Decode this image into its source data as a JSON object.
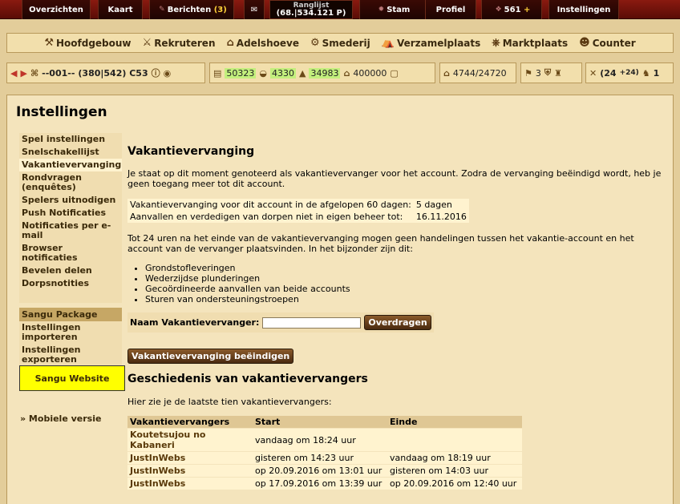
{
  "topbar": {
    "overview": "Overzichten",
    "map": "Kaart",
    "reports": "Berichten",
    "reports_count": "(3)",
    "ranking": "Ranglijst",
    "ranking_value": "(68.|534.121 P)",
    "tribe": "Stam",
    "profile": "Profiel",
    "premium": "561",
    "premium_plus": "+",
    "settings": "Instellingen"
  },
  "buildings": [
    {
      "label": "Hoofdgebouw",
      "icon": "hammer-icon"
    },
    {
      "label": "Rekruteren",
      "icon": "swords-icon"
    },
    {
      "label": "Adelshoeve",
      "icon": "house-icon"
    },
    {
      "label": "Smederij",
      "icon": "anvil-icon"
    },
    {
      "label": "Verzamelplaats",
      "icon": "tent-icon"
    },
    {
      "label": "Marktplaats",
      "icon": "wheel-icon"
    },
    {
      "label": "Counter",
      "icon": "person-icon"
    }
  ],
  "village": {
    "name": "--001--",
    "coords": "(380|542) C53"
  },
  "resources": {
    "wood": "50323",
    "clay": "4330",
    "iron": "34983",
    "storage": "400000",
    "population": "4744/24720"
  },
  "counters": {
    "a": "3",
    "attacks": "(24",
    "attacks_plus": "+24)",
    "support": "1"
  },
  "page_title": "Instellingen",
  "menu": [
    "Spel instellingen",
    "Snelschakellijst",
    "Vakantievervanging",
    "Rondvragen (enquêtes)",
    "Spelers uitnodigen",
    "Push Notificaties",
    "Notificaties per e-mail",
    "Browser notificaties",
    "Bevelen delen",
    "Dorpsnotities"
  ],
  "sangu": {
    "head": "Sangu Package",
    "import": "Instellingen importeren",
    "export": "Instellingen exporteren",
    "website": "Sangu Website"
  },
  "mobile": "» Mobiele versie",
  "vacation": {
    "title": "Vakantievervanging",
    "intro": "Je staat op dit moment genoteerd als vakantievervanger voor het account. Zodra de vervanging beëindigd wordt, heb je geen toegang meer tot dit account.",
    "row1_label": "Vakantievervanging voor dit account in de afgelopen 60 dagen:",
    "row1_value": "5 dagen",
    "row2_label": "Aanvallen en verdedigen van dorpen niet in eigen beheer tot:",
    "row2_value": "16.11.2016",
    "rules": "Tot 24 uren na het einde van de vakantievervanging mogen geen handelingen tussen het vakantie-account en het account van de vervanger plaatsvinden. In het bijzonder zijn dit:",
    "list": [
      "Grondstofleveringen",
      "Wederzijdse plunderingen",
      "Gecoördineerde aanvallen van beide accounts",
      "Sturen van ondersteuningstroepen"
    ],
    "name_label": "Naam Vakantievervanger:",
    "name_value": "",
    "transfer_button": "Overdragen",
    "end_button": "Vakantievervanging beëindigen"
  },
  "history": {
    "title": "Geschiedenis van vakantievervangers",
    "intro": "Hier zie je de laatste tien vakantievervangers:",
    "headers": [
      "Vakantievervangers",
      "Start",
      "Einde"
    ],
    "rows": [
      [
        "Koutetsujou no Kabaneri",
        "vandaag om 18:24 uur",
        ""
      ],
      [
        "JustInWebs",
        "gisteren om 14:23 uur",
        "vandaag om 18:19 uur"
      ],
      [
        "JustInWebs",
        "op 20.09.2016 om 13:01 uur",
        "gisteren om 14:03 uur"
      ],
      [
        "JustInWebs",
        "op 17.09.2016 om 13:39 uur",
        "op 20.09.2016 om 12:40 uur"
      ]
    ]
  }
}
